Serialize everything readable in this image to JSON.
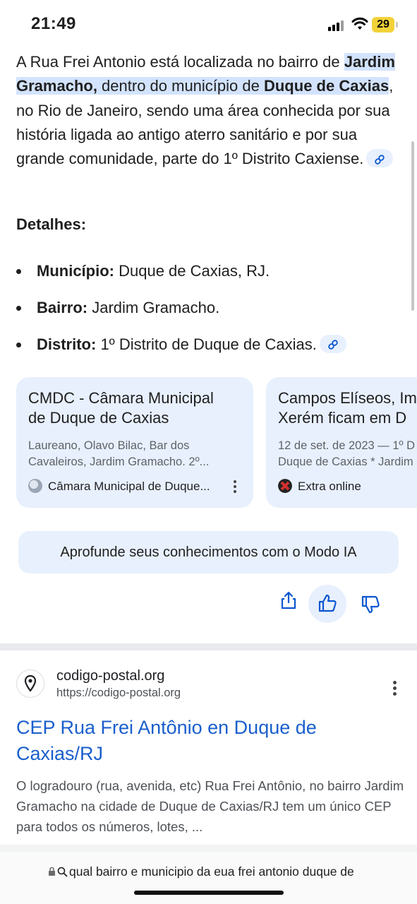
{
  "status_bar": {
    "time": "21:49",
    "battery": "29"
  },
  "ai_overview": {
    "p_lead": "A Rua Frei Antonio está localizada no bairro de ",
    "p_hl_bold1": "Jardim Gramacho,",
    "p_hl_mid": " dentro do município de ",
    "p_hl_bold2": "Duque de Caxias",
    "p_tail": ", no Rio de Janeiro, sendo uma área conhecida por sua história ligada ao antigo aterro sanitário e por sua grande comunidade, parte do 1º Distrito Caxiense.",
    "details_title": "Detalhes:",
    "details": [
      {
        "label": "Município:",
        "value": " Duque de Caxias, RJ."
      },
      {
        "label": "Bairro:",
        "value": " Jardim Gramacho."
      },
      {
        "label": "Distrito:",
        "value": " 1º Distrito de Duque de Caxias."
      }
    ],
    "cards": [
      {
        "title_line1": "CMDC - Câmara Municipal",
        "title_line2": "de Duque de Caxias",
        "snippet_line1": "Laureano, Olavo Bilac, Bar dos",
        "snippet_line2": "Cavaleiros, Jardim Gramacho. 2º...",
        "source": "Câmara Municipal de Duque..."
      },
      {
        "title_line1": "Campos Elíseos, Im",
        "title_line2": "Xerém ficam em D",
        "snippet_line1": "12 de set. de 2023 — 1º D",
        "snippet_line2": "Duque de Caxias * Jardim",
        "source": "Extra online"
      }
    ],
    "ai_mode_button": "Aprofunde seus conhecimentos com o Modo IA"
  },
  "result": {
    "site_name": "codigo-postal.org",
    "url": "https://codigo-postal.org",
    "title_line1": "CEP Rua Frei Antônio en Duque de",
    "title_line2": "Caxias/RJ",
    "snippet": "O logradouro (rua, avenida, etc) Rua Frei Antônio, no bairro Jardim Gramacho na cidade de Duque de Caxias/RJ tem um único CEP para todos os números, lotes, ..."
  },
  "address_bar": {
    "query": "qual bairro e municipio da eua frei antonio duque de"
  },
  "colors": {
    "chip_bg": "#e8f0fe",
    "highlight": "#d3e3fd",
    "link": "#1a5fcc",
    "icon_blue": "#0b57d0"
  },
  "icons": [
    "link-icon",
    "share-icon",
    "thumbs-up-icon",
    "thumbs-down-icon",
    "location-pin-icon",
    "lock-icon",
    "search-icon",
    "globe-icon"
  ]
}
